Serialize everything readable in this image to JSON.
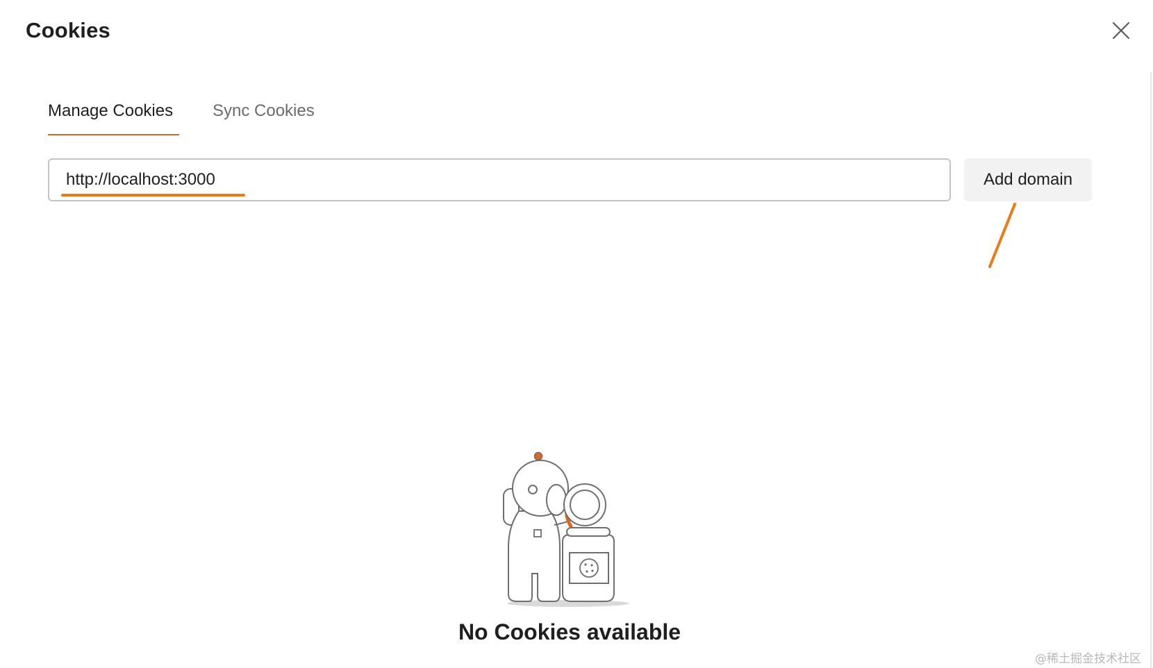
{
  "dialog": {
    "title": "Cookies",
    "close_icon": "close-icon"
  },
  "tabs": [
    {
      "label": "Manage Cookies",
      "active": true
    },
    {
      "label": "Sync Cookies",
      "active": false
    }
  ],
  "domain_input": {
    "value": "http://localhost:3000",
    "placeholder": ""
  },
  "add_domain_button": {
    "label": "Add domain"
  },
  "empty_state": {
    "illustration": "astronaut-cookie-jar-illustration",
    "message": "No Cookies available"
  },
  "watermark": {
    "text": "@稀土掘金技术社区"
  },
  "colors": {
    "accent": "#e0661f",
    "annotation": "#f07a12",
    "button_bg": "#f2f2f2",
    "input_border": "#c4c4c4",
    "inactive_tab": "#6b6b6b"
  }
}
